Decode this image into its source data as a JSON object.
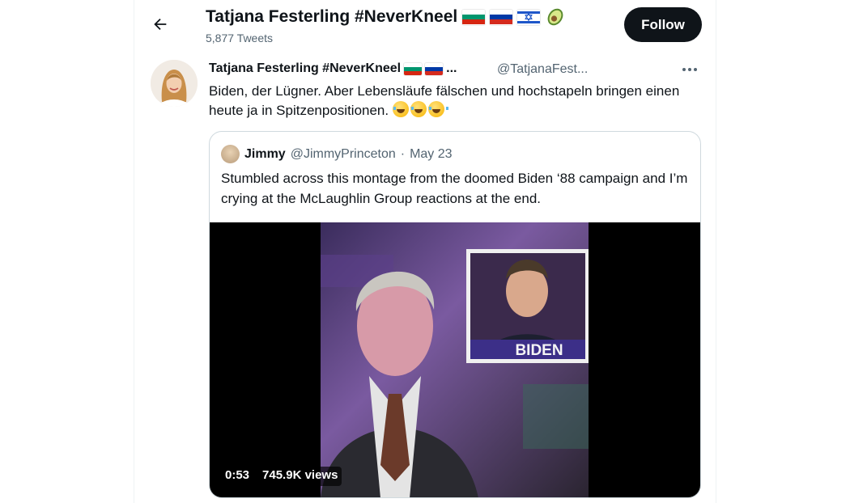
{
  "header": {
    "title": "Tatjana Festerling #NeverKneel",
    "tweet_count": "5,877 Tweets",
    "follow_label": "Follow"
  },
  "tweet": {
    "author_name": "Tatjana Festerling #NeverKneel",
    "name_truncation": "...",
    "handle": "@TatjanaFest...",
    "text": "Biden, der Lügner. Aber Lebensläufe fälschen und hochstapeln bringen einen heute ja in Spitzenpositionen."
  },
  "quote": {
    "author_name": "Jimmy",
    "handle": "@JimmyPrinceton",
    "separator": "·",
    "date": "May 23",
    "text": "Stumbled across this montage from the doomed Biden ‘88 campaign and I’m crying at the McLaughlin Group reactions at the end.",
    "video": {
      "caption": "BIDEN",
      "duration": "0:53",
      "views": "745.9K views"
    }
  },
  "icons": [
    "back-arrow-icon",
    "more-icon",
    "bulgaria-flag-icon",
    "russia-flag-icon",
    "israel-flag-icon",
    "avocado-icon",
    "laughing-emoji-icon"
  ],
  "colors": {
    "text_primary": "#0f1419",
    "text_secondary": "#536471",
    "follow_button": "#0f1419",
    "border": "#cfd9de"
  }
}
